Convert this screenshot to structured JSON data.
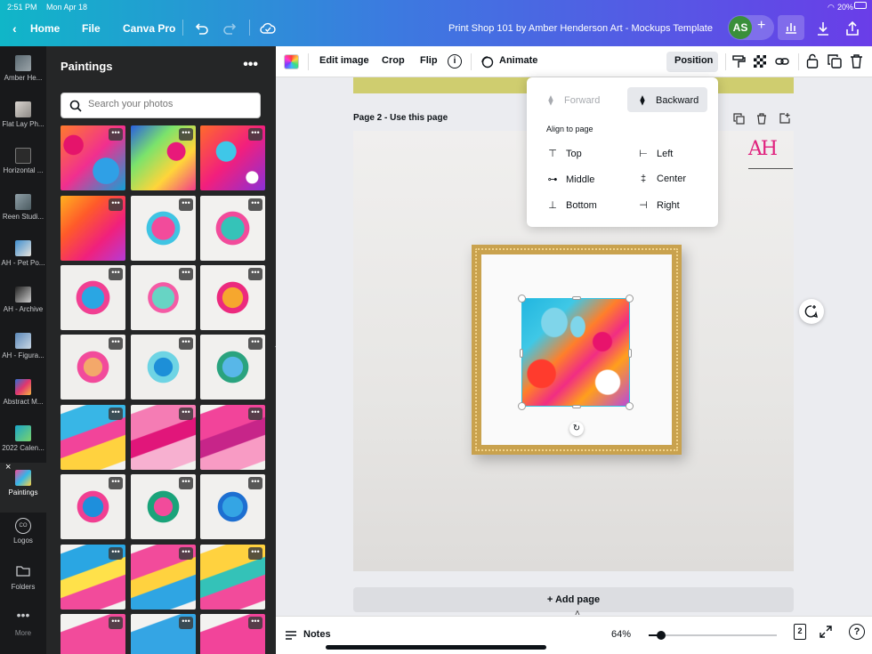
{
  "status_bar": {
    "time": "2:51 PM",
    "date": "Mon Apr 18",
    "battery": "20%"
  },
  "topbar": {
    "home_label": "Home",
    "file_label": "File",
    "canva_pro_label": "Canva Pro",
    "doc_title": "Print Shop 101 by Amber Henderson Art - Mockups Template",
    "avatar_initials": "AS",
    "share_plus": "+"
  },
  "rail": {
    "items": [
      {
        "label": "Amber He..."
      },
      {
        "label": "Flat Lay Ph..."
      },
      {
        "label": "Horizontal ..."
      },
      {
        "label": "Reen Studi..."
      },
      {
        "label": "AH - Pet Po..."
      },
      {
        "label": "AH - Archive"
      },
      {
        "label": "AH - Figura..."
      },
      {
        "label": "Abstract M..."
      },
      {
        "label": "2022 Calen..."
      },
      {
        "label": "Paintings"
      },
      {
        "label": "Logos"
      },
      {
        "label": "Folders"
      },
      {
        "label": "More"
      }
    ]
  },
  "panel": {
    "title": "Paintings",
    "search_placeholder": "Search your photos",
    "more": "•••"
  },
  "context_bar": {
    "edit_image": "Edit image",
    "crop": "Crop",
    "flip": "Flip",
    "animate": "Animate",
    "position": "Position"
  },
  "canvas": {
    "page_label": "Page 2 - Use this page",
    "add_page": "+ Add page",
    "logo_text": "AH"
  },
  "position_menu": {
    "forward": "Forward",
    "backward": "Backward",
    "align_heading": "Align to page",
    "top": "Top",
    "left": "Left",
    "middle": "Middle",
    "center": "Center",
    "bottom": "Bottom",
    "right": "Right"
  },
  "bottom_bar": {
    "notes": "Notes",
    "zoom": "64%",
    "page_count": "2",
    "zoom_level": 0.1
  },
  "colors": {
    "accent": "#7d2ae8",
    "selection": "#35c2e2",
    "frame_gold": "#c9a24e"
  }
}
